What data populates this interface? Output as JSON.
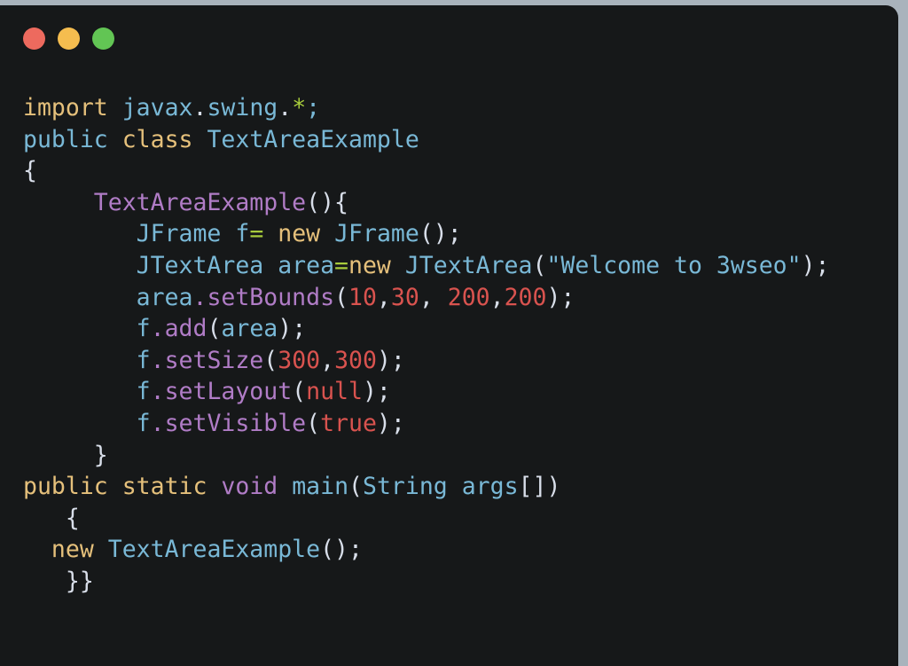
{
  "window": {
    "chrome_background": "#a9b3bc",
    "editor_background": "#161819",
    "traffic_lights": [
      {
        "name": "close",
        "label": "Close",
        "color": "#ed6a5e"
      },
      {
        "name": "minimize",
        "label": "Minimize",
        "color": "#f5bd4f"
      },
      {
        "name": "zoom",
        "label": "Zoom",
        "color": "#62c554"
      }
    ]
  },
  "theme": {
    "keyword": "#e5c07b",
    "identifier": "#79b8d6",
    "method": "#b07cc6",
    "literal": "#d9534f",
    "operator": "#a8cc3c",
    "punctuation": "#d8dee9"
  },
  "code": {
    "language": "Java",
    "plain_text": "import javax.swing.*;\npublic class TextAreaExample\n{\n     TextAreaExample(){\n        JFrame f= new JFrame();\n        JTextArea area=new JTextArea(\"Welcome to 3wseo\");\n        area.setBounds(10,30, 200,200);\n        f.add(area);\n        f.setSize(300,300);\n        f.setLayout(null);\n        f.setVisible(true);\n     }\npublic static void main(String args[])\n   {\n  new TextAreaExample();\n   }}",
    "lines": [
      {
        "n": 1,
        "tokens": [
          {
            "t": "import",
            "c": "k-yellow"
          },
          {
            "t": " ",
            "c": "k-punct"
          },
          {
            "t": "javax",
            "c": "k-blue"
          },
          {
            "t": ".",
            "c": "k-punct"
          },
          {
            "t": "swing",
            "c": "k-blue"
          },
          {
            "t": ".",
            "c": "k-punct"
          },
          {
            "t": "*",
            "c": "k-green"
          },
          {
            "t": ";",
            "c": "k-blue"
          }
        ]
      },
      {
        "n": 2,
        "tokens": [
          {
            "t": "public",
            "c": "k-blue"
          },
          {
            "t": " ",
            "c": "k-punct"
          },
          {
            "t": "class",
            "c": "k-yellow"
          },
          {
            "t": " ",
            "c": "k-punct"
          },
          {
            "t": "TextAreaExample",
            "c": "k-blue"
          }
        ]
      },
      {
        "n": 3,
        "tokens": [
          {
            "t": "{",
            "c": "k-punct"
          }
        ]
      },
      {
        "n": 4,
        "tokens": [
          {
            "t": "     ",
            "c": "k-punct"
          },
          {
            "t": "TextAreaExample",
            "c": "k-purple"
          },
          {
            "t": "(){",
            "c": "k-punct"
          }
        ]
      },
      {
        "n": 5,
        "tokens": [
          {
            "t": "        ",
            "c": "k-punct"
          },
          {
            "t": "JFrame",
            "c": "k-blue"
          },
          {
            "t": " ",
            "c": "k-punct"
          },
          {
            "t": "f",
            "c": "k-blue"
          },
          {
            "t": "=",
            "c": "k-green"
          },
          {
            "t": " ",
            "c": "k-punct"
          },
          {
            "t": "new",
            "c": "k-yellow"
          },
          {
            "t": " ",
            "c": "k-punct"
          },
          {
            "t": "JFrame",
            "c": "k-blue"
          },
          {
            "t": "();",
            "c": "k-punct"
          }
        ]
      },
      {
        "n": 6,
        "tokens": [
          {
            "t": "        ",
            "c": "k-punct"
          },
          {
            "t": "JTextArea",
            "c": "k-blue"
          },
          {
            "t": " ",
            "c": "k-punct"
          },
          {
            "t": "area",
            "c": "k-blue"
          },
          {
            "t": "=",
            "c": "k-green"
          },
          {
            "t": "new",
            "c": "k-yellow"
          },
          {
            "t": " ",
            "c": "k-punct"
          },
          {
            "t": "JTextArea",
            "c": "k-blue"
          },
          {
            "t": "(",
            "c": "k-punct"
          },
          {
            "t": "\"Welcome to 3wseo\"",
            "c": "k-blue"
          },
          {
            "t": ");",
            "c": "k-punct"
          }
        ]
      },
      {
        "n": 7,
        "tokens": [
          {
            "t": "        ",
            "c": "k-punct"
          },
          {
            "t": "area",
            "c": "k-blue"
          },
          {
            "t": ".",
            "c": "k-purple"
          },
          {
            "t": "setBounds",
            "c": "k-purple"
          },
          {
            "t": "(",
            "c": "k-punct"
          },
          {
            "t": "10",
            "c": "k-red"
          },
          {
            "t": ",",
            "c": "k-punct"
          },
          {
            "t": "30",
            "c": "k-red"
          },
          {
            "t": ", ",
            "c": "k-punct"
          },
          {
            "t": "200",
            "c": "k-red"
          },
          {
            "t": ",",
            "c": "k-punct"
          },
          {
            "t": "200",
            "c": "k-red"
          },
          {
            "t": ");",
            "c": "k-punct"
          }
        ]
      },
      {
        "n": 8,
        "tokens": [
          {
            "t": "        ",
            "c": "k-punct"
          },
          {
            "t": "f",
            "c": "k-blue"
          },
          {
            "t": ".",
            "c": "k-purple"
          },
          {
            "t": "add",
            "c": "k-purple"
          },
          {
            "t": "(",
            "c": "k-punct"
          },
          {
            "t": "area",
            "c": "k-blue"
          },
          {
            "t": ");",
            "c": "k-punct"
          }
        ]
      },
      {
        "n": 9,
        "tokens": [
          {
            "t": "        ",
            "c": "k-punct"
          },
          {
            "t": "f",
            "c": "k-blue"
          },
          {
            "t": ".",
            "c": "k-purple"
          },
          {
            "t": "setSize",
            "c": "k-purple"
          },
          {
            "t": "(",
            "c": "k-punct"
          },
          {
            "t": "300",
            "c": "k-red"
          },
          {
            "t": ",",
            "c": "k-punct"
          },
          {
            "t": "300",
            "c": "k-red"
          },
          {
            "t": ");",
            "c": "k-punct"
          }
        ]
      },
      {
        "n": 10,
        "tokens": [
          {
            "t": "        ",
            "c": "k-punct"
          },
          {
            "t": "f",
            "c": "k-blue"
          },
          {
            "t": ".",
            "c": "k-purple"
          },
          {
            "t": "setLayout",
            "c": "k-purple"
          },
          {
            "t": "(",
            "c": "k-punct"
          },
          {
            "t": "null",
            "c": "k-red"
          },
          {
            "t": ");",
            "c": "k-punct"
          }
        ]
      },
      {
        "n": 11,
        "tokens": [
          {
            "t": "        ",
            "c": "k-punct"
          },
          {
            "t": "f",
            "c": "k-blue"
          },
          {
            "t": ".",
            "c": "k-purple"
          },
          {
            "t": "setVisible",
            "c": "k-purple"
          },
          {
            "t": "(",
            "c": "k-punct"
          },
          {
            "t": "true",
            "c": "k-red"
          },
          {
            "t": ");",
            "c": "k-punct"
          }
        ]
      },
      {
        "n": 12,
        "tokens": [
          {
            "t": "     }",
            "c": "k-punct"
          }
        ]
      },
      {
        "n": 13,
        "tokens": [
          {
            "t": "public",
            "c": "k-yellow"
          },
          {
            "t": " ",
            "c": "k-punct"
          },
          {
            "t": "static",
            "c": "k-yellow"
          },
          {
            "t": " ",
            "c": "k-punct"
          },
          {
            "t": "void",
            "c": "k-purple"
          },
          {
            "t": " ",
            "c": "k-punct"
          },
          {
            "t": "main",
            "c": "k-blue"
          },
          {
            "t": "(",
            "c": "k-punct"
          },
          {
            "t": "String",
            "c": "k-blue"
          },
          {
            "t": " ",
            "c": "k-punct"
          },
          {
            "t": "args",
            "c": "k-blue"
          },
          {
            "t": "[])",
            "c": "k-punct"
          }
        ]
      },
      {
        "n": 14,
        "tokens": [
          {
            "t": "   {",
            "c": "k-punct"
          }
        ]
      },
      {
        "n": 15,
        "tokens": [
          {
            "t": "  ",
            "c": "k-punct"
          },
          {
            "t": "new",
            "c": "k-yellow"
          },
          {
            "t": " ",
            "c": "k-punct"
          },
          {
            "t": "TextAreaExample",
            "c": "k-blue"
          },
          {
            "t": "();",
            "c": "k-punct"
          }
        ]
      },
      {
        "n": 16,
        "tokens": [
          {
            "t": "   }}",
            "c": "k-punct"
          }
        ]
      }
    ]
  }
}
